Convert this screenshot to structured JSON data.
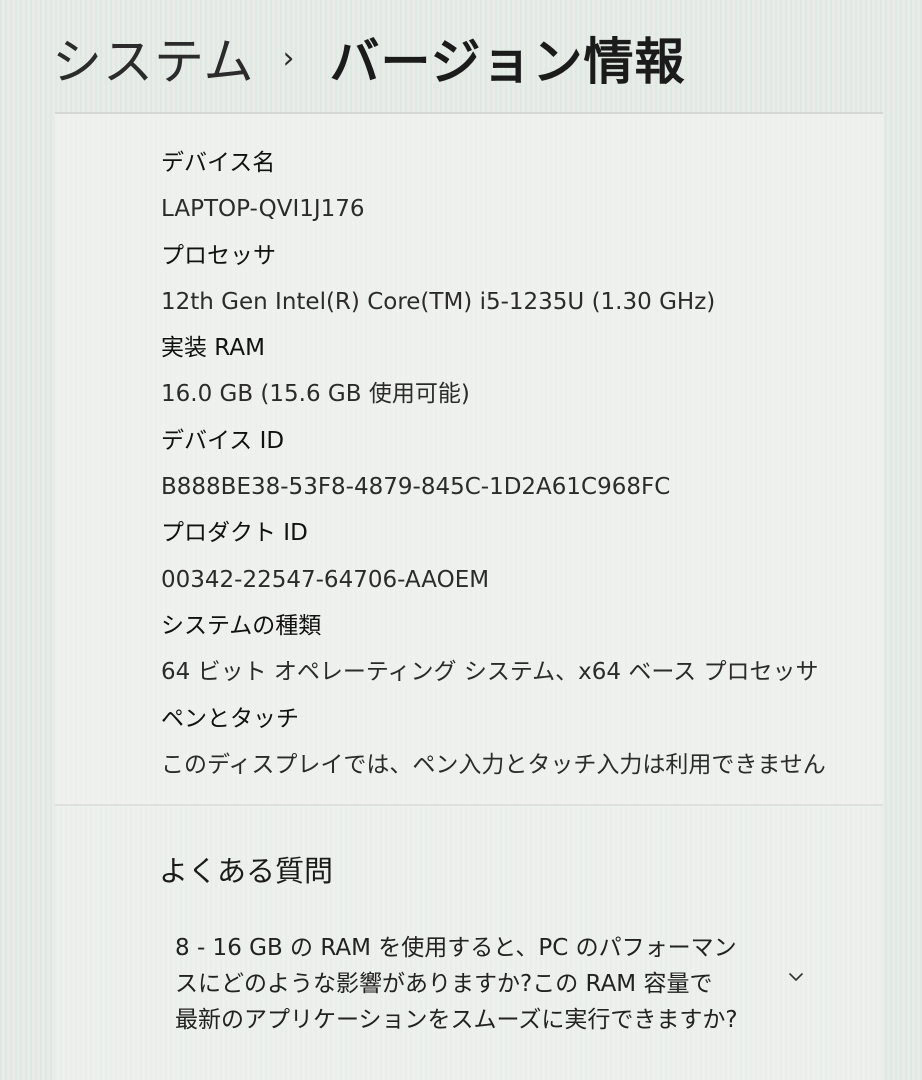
{
  "breadcrumb": {
    "parent": "システム",
    "separator": "›",
    "current": "バージョン情報"
  },
  "device_specs": [
    {
      "label": "デバイス名",
      "value": "LAPTOP-QVI1J176"
    },
    {
      "label": "プロセッサ",
      "value": "12th Gen Intel(R) Core(TM) i5-1235U (1.30 GHz)"
    },
    {
      "label": "実装 RAM",
      "value": "16.0 GB (15.6 GB 使用可能)"
    },
    {
      "label": "デバイス ID",
      "value": "B888BE38-53F8-4879-845C-1D2A61C968FC"
    },
    {
      "label": "プロダクト ID",
      "value": "00342-22547-64706-AAOEM"
    },
    {
      "label": "システムの種類",
      "value": "64 ビット オペレーティング システム、x64 ベース プロセッサ"
    },
    {
      "label": "ペンとタッチ",
      "value": "このディスプレイでは、ペン入力とタッチ入力は利用できません"
    }
  ],
  "faq": {
    "title": "よくある質問",
    "question_lines": [
      "8 - 16 GB の RAM を使用すると、PC のパフォーマン",
      "スにどのような影響がありますか?この RAM 容量で",
      "最新のアプリケーションをスムーズに実行できますか?"
    ],
    "expand_icon": "chevron-down-icon"
  }
}
